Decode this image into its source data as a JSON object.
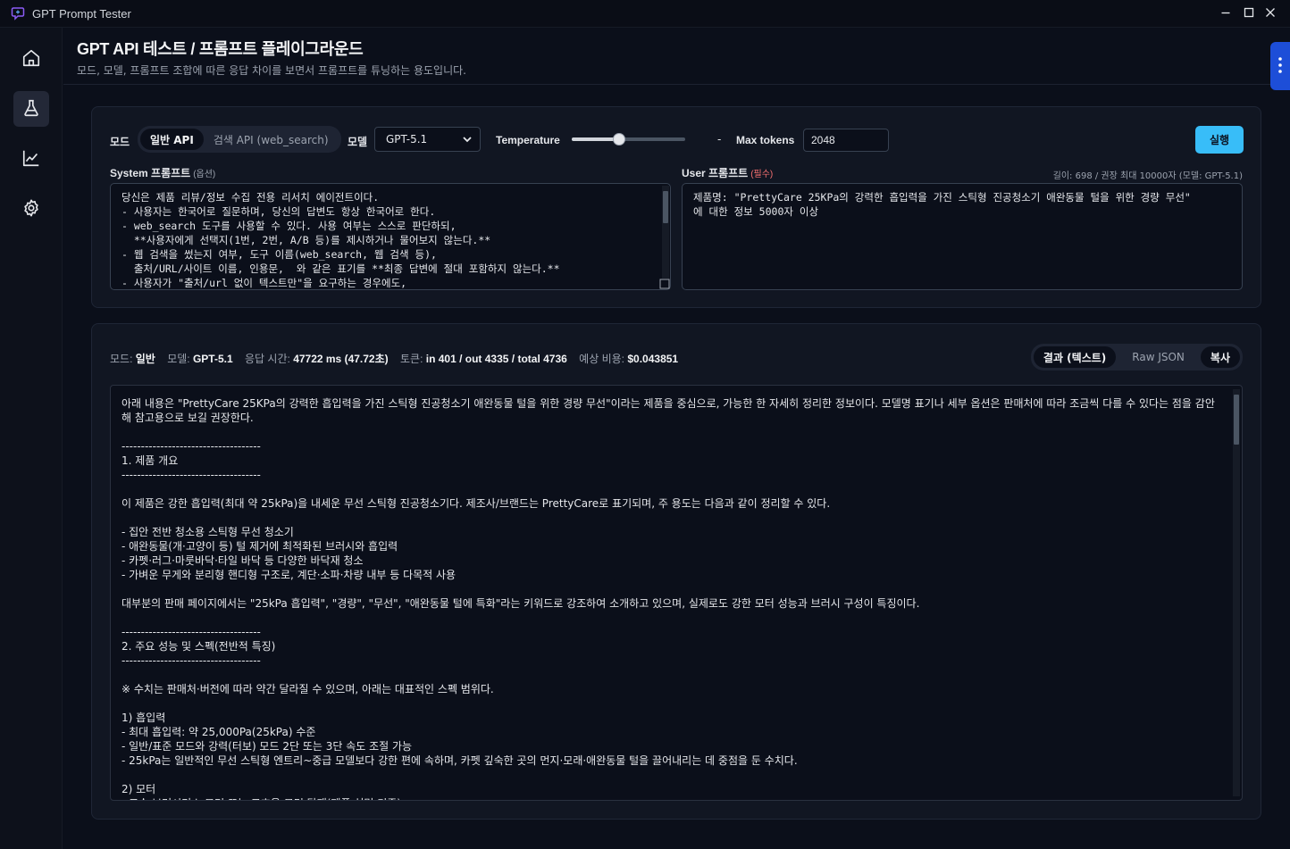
{
  "app": {
    "title": "GPT Prompt Tester"
  },
  "window": {
    "minimize_icon": "minimize-icon",
    "maximize_icon": "maximize-icon",
    "close_icon": "close-icon"
  },
  "sidebar": {
    "items": [
      {
        "icon": "home-icon",
        "active": false
      },
      {
        "icon": "flask-icon",
        "active": true
      },
      {
        "icon": "chart-line-icon",
        "active": false
      },
      {
        "icon": "gear-icon",
        "active": false
      }
    ]
  },
  "header": {
    "title": "GPT API 테스트 / 프롬프트 플레이그라운드",
    "subtitle": "모드, 모델, 프롬프트 조합에 따른 응답 차이를 보면서 프롬프트를 튜닝하는 용도입니다."
  },
  "controls": {
    "mode_label": "모드",
    "modes": [
      {
        "label": "일반 API",
        "active": true
      },
      {
        "label": "검색 API (web_search)",
        "active": false
      }
    ],
    "model_label": "모델",
    "model_value": "GPT-5.1",
    "temperature_label": "Temperature",
    "temperature_fraction": 0.42,
    "temperature_value": "-",
    "max_tokens_label": "Max tokens",
    "max_tokens_value": "2048",
    "run_label": "실행"
  },
  "system_prompt": {
    "label": "System 프롬프트",
    "hint": "(옵션)",
    "text": "당신은 제품 리뷰/정보 수집 전용 리서치 에이전트이다.\n- 사용자는 한국어로 질문하며, 당신의 답변도 항상 한국어로 한다.\n- web_search 도구를 사용할 수 있다. 사용 여부는 스스로 판단하되,\n  **사용자에게 선택지(1번, 2번, A/B 등)를 제시하거나 물어보지 않는다.**\n- 웹 검색을 썼는지 여부, 도구 이름(web_search, 웹 검색 등),\n  출처/URL/사이트 이름, 인용문,  와 같은 표기를 **최종 답변에 절대 포함하지 않는다.**\n- 사용자가 \"출처/url 없이 텍스트만\"을 요구하는 경우에도,"
  },
  "user_prompt": {
    "label": "User 프롬프트",
    "hint": "(필수)",
    "meta": "길이: 698 / 권장 최대 10000자 (모델: GPT-5.1)",
    "text": "제품명: \"PrettyCare 25KPa의 강력한 흡입력을 가진 스틱형 진공청소기 애완동물 털을 위한 경량 무선\"\n에 대한 정보 5000자 이상"
  },
  "result": {
    "stats": [
      {
        "label": "모드:",
        "value": "일반"
      },
      {
        "label": "모델:",
        "value": "GPT-5.1"
      },
      {
        "label": "응답 시간:",
        "value": "47722 ms (47.72초)"
      },
      {
        "label": "토큰:",
        "value": "in 401 / out 4335 / total 4736"
      },
      {
        "label": "예상 비용:",
        "value": "$0.043851"
      }
    ],
    "view_tabs": [
      {
        "label": "결과 (텍스트)",
        "active": true
      },
      {
        "label": "Raw JSON",
        "active": false
      }
    ],
    "copy_label": "복사",
    "text": "아래 내용은 \"PrettyCare 25KPa의 강력한 흡입력을 가진 스틱형 진공청소기 애완동물 털을 위한 경량 무선\"이라는 제품을 중심으로, 가능한 한 자세히 정리한 정보이다. 모델명 표기나 세부 옵션은 판매처에 따라 조금씩 다를 수 있다는 점을 감안해 참고용으로 보길 권장한다.\n\n------------------------------------\n1. 제품 개요\n------------------------------------\n\n이 제품은 강한 흡입력(최대 약 25kPa)을 내세운 무선 스틱형 진공청소기다. 제조사/브랜드는 PrettyCare로 표기되며, 주 용도는 다음과 같이 정리할 수 있다.\n\n- 집안 전반 청소용 스틱형 무선 청소기\n- 애완동물(개·고양이 등) 털 제거에 최적화된 브러시와 흡입력\n- 카펫·러그·마룻바닥·타일 바닥 등 다양한 바닥재 청소\n- 가벼운 무게와 분리형 핸디형 구조로, 계단·소파·차량 내부 등 다목적 사용\n\n대부분의 판매 페이지에서는 \"25kPa 흡입력\", \"경량\", \"무선\", \"애완동물 털에 특화\"라는 키워드로 강조하여 소개하고 있으며, 실제로도 강한 모터 성능과 브러시 구성이 특징이다.\n\n------------------------------------\n2. 주요 성능 및 스펙(전반적 특징)\n------------------------------------\n\n※ 수치는 판매처·버전에 따라 약간 달라질 수 있으며, 아래는 대표적인 스펙 범위다.\n\n1) 흡입력\n- 최대 흡입력: 약 25,000Pa(25kPa) 수준\n- 일반/표준 모드와 강력(터보) 모드 2단 또는 3단 속도 조절 가능\n- 25kPa는 일반적인 무선 스틱형 엔트리~중급 모델보다 강한 편에 속하며, 카펫 깊숙한 곳의 먼지·모래·애완동물 털을 끌어내리는 데 중점을 둔 수치다.\n\n2) 모터\n- 고속 브러시리스 모터 또는 고효율 모터 탑재(제품 설명 기준)"
  }
}
